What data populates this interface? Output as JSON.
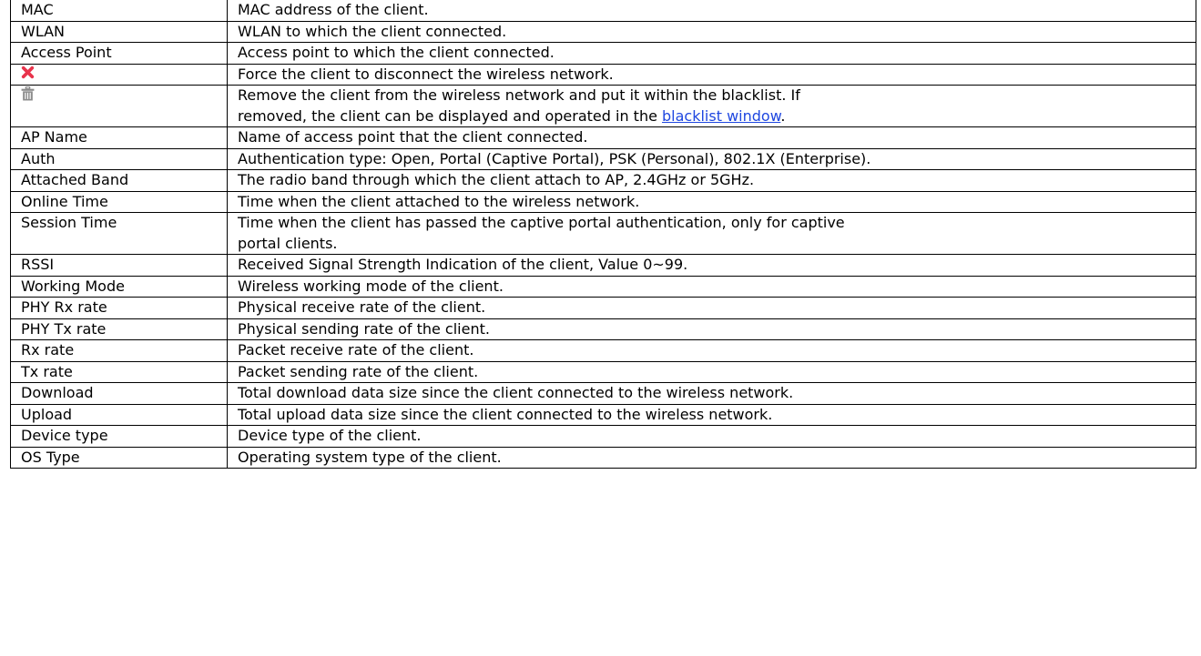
{
  "rows": [
    {
      "name": "MAC",
      "description": "MAC address of the client."
    },
    {
      "name": "WLAN",
      "description": "WLAN to which the client connected."
    },
    {
      "name": "Access Point",
      "description": "Access point to which the client connected."
    },
    {
      "icon": "close-icon",
      "description": "Force the client to disconnect the wireless network."
    },
    {
      "icon": "trash-icon",
      "description_line1": "Remove the client from the wireless network and put it within the blacklist. If",
      "description_line2_prefix": "removed, the client can be displayed and operated in the ",
      "link_text": "blacklist window",
      "description_line2_suffix": "."
    },
    {
      "name": "AP Name",
      "description": "Name of access point that the client connected."
    },
    {
      "name": "Auth",
      "description": "Authentication type: Open, Portal (Captive Portal), PSK (Personal), 802.1X (Enterprise)."
    },
    {
      "name": "Attached Band",
      "description": "The radio band through which the client attach to AP, 2.4GHz or 5GHz."
    },
    {
      "name": "Online Time",
      "description": "Time when the client attached to the wireless network."
    },
    {
      "name": "Session Time",
      "description_line1": "Time when the client has passed the captive portal authentication, only for captive",
      "description_line2": "portal clients."
    },
    {
      "name": "RSSI",
      "description": "Received Signal Strength Indication of the client, Value 0~99."
    },
    {
      "name": "Working Mode",
      "description": "Wireless working mode of the client."
    },
    {
      "name": "PHY Rx rate",
      "description": "Physical receive rate of the client."
    },
    {
      "name": "PHY Tx rate",
      "description": "Physical sending rate of the client."
    },
    {
      "name": "Rx rate",
      "description": "Packet receive rate of the client."
    },
    {
      "name": "Tx rate",
      "description": "Packet sending rate of the client."
    },
    {
      "name": "Download",
      "description": "Total download data size since the client connected to the wireless network."
    },
    {
      "name": "Upload",
      "description": "Total upload data size since the client connected to the wireless network."
    },
    {
      "name": "Device type",
      "description": "Device type of the client."
    },
    {
      "name": "OS Type",
      "description": "Operating system type of the client."
    }
  ],
  "colors": {
    "close_icon": "#e8344c",
    "trash_icon": "#8c8c8c",
    "link": "#1f47e0"
  }
}
